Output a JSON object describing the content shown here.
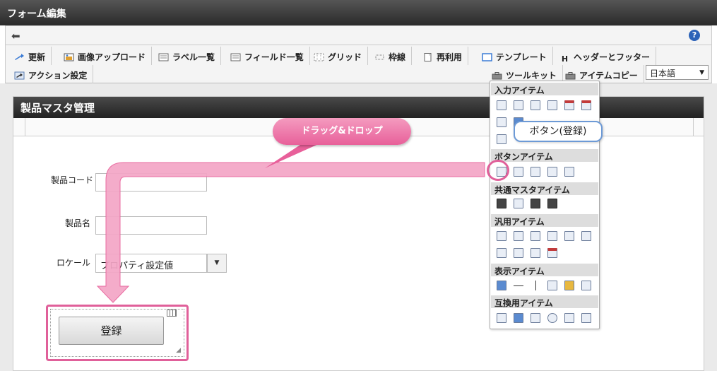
{
  "window": {
    "title": "フォーム編集"
  },
  "nav": {
    "back_icon": "arrow-left-icon",
    "help_icon": "help-icon",
    "help_glyph": "?"
  },
  "toolbar": {
    "row1": [
      {
        "label": "更新",
        "icon": "refresh-icon"
      },
      {
        "label": "画像アップロード",
        "icon": "image-upload-icon"
      },
      {
        "label": "ラベル一覧",
        "icon": "label-list-icon"
      },
      {
        "label": "フィールド一覧",
        "icon": "field-list-icon"
      },
      {
        "label": "グリッド",
        "icon": "grid-icon"
      },
      {
        "label": "枠線",
        "icon": "border-icon"
      },
      {
        "label": "再利用",
        "icon": "reuse-icon"
      },
      {
        "label": "テンプレート",
        "icon": "template-icon"
      },
      {
        "label": "ヘッダーとフッター",
        "icon": "header-footer-icon",
        "glyph": "H"
      }
    ],
    "row2": [
      {
        "label": "アクション設定",
        "icon": "action-icon"
      },
      {
        "label": "ツールキット",
        "icon": "toolkit-icon"
      },
      {
        "label": "アイテムコピー",
        "icon": "item-copy-icon"
      }
    ],
    "language": "日本語",
    "language_arrow": "▼"
  },
  "form": {
    "title": "製品マスタ管理",
    "fields": [
      {
        "label": "製品コード"
      },
      {
        "label": "製品名"
      },
      {
        "label": "ロケール",
        "value": "プロパティ設定値",
        "arrow": "▼"
      }
    ],
    "submit_label": "登録",
    "resize_glyph": "◢"
  },
  "palette": {
    "categories": [
      "入力アイテム",
      "ボタンアイテム",
      "共通マスタアイテム",
      "汎用アイテム",
      "表示アイテム",
      "互換用アイテム"
    ]
  },
  "annotations": {
    "drag_label": "ドラッグ&ドロップ",
    "callout_label": "ボタン(登録)",
    "accent_color": "#e0609a",
    "callout_color": "#6d9ad6"
  }
}
